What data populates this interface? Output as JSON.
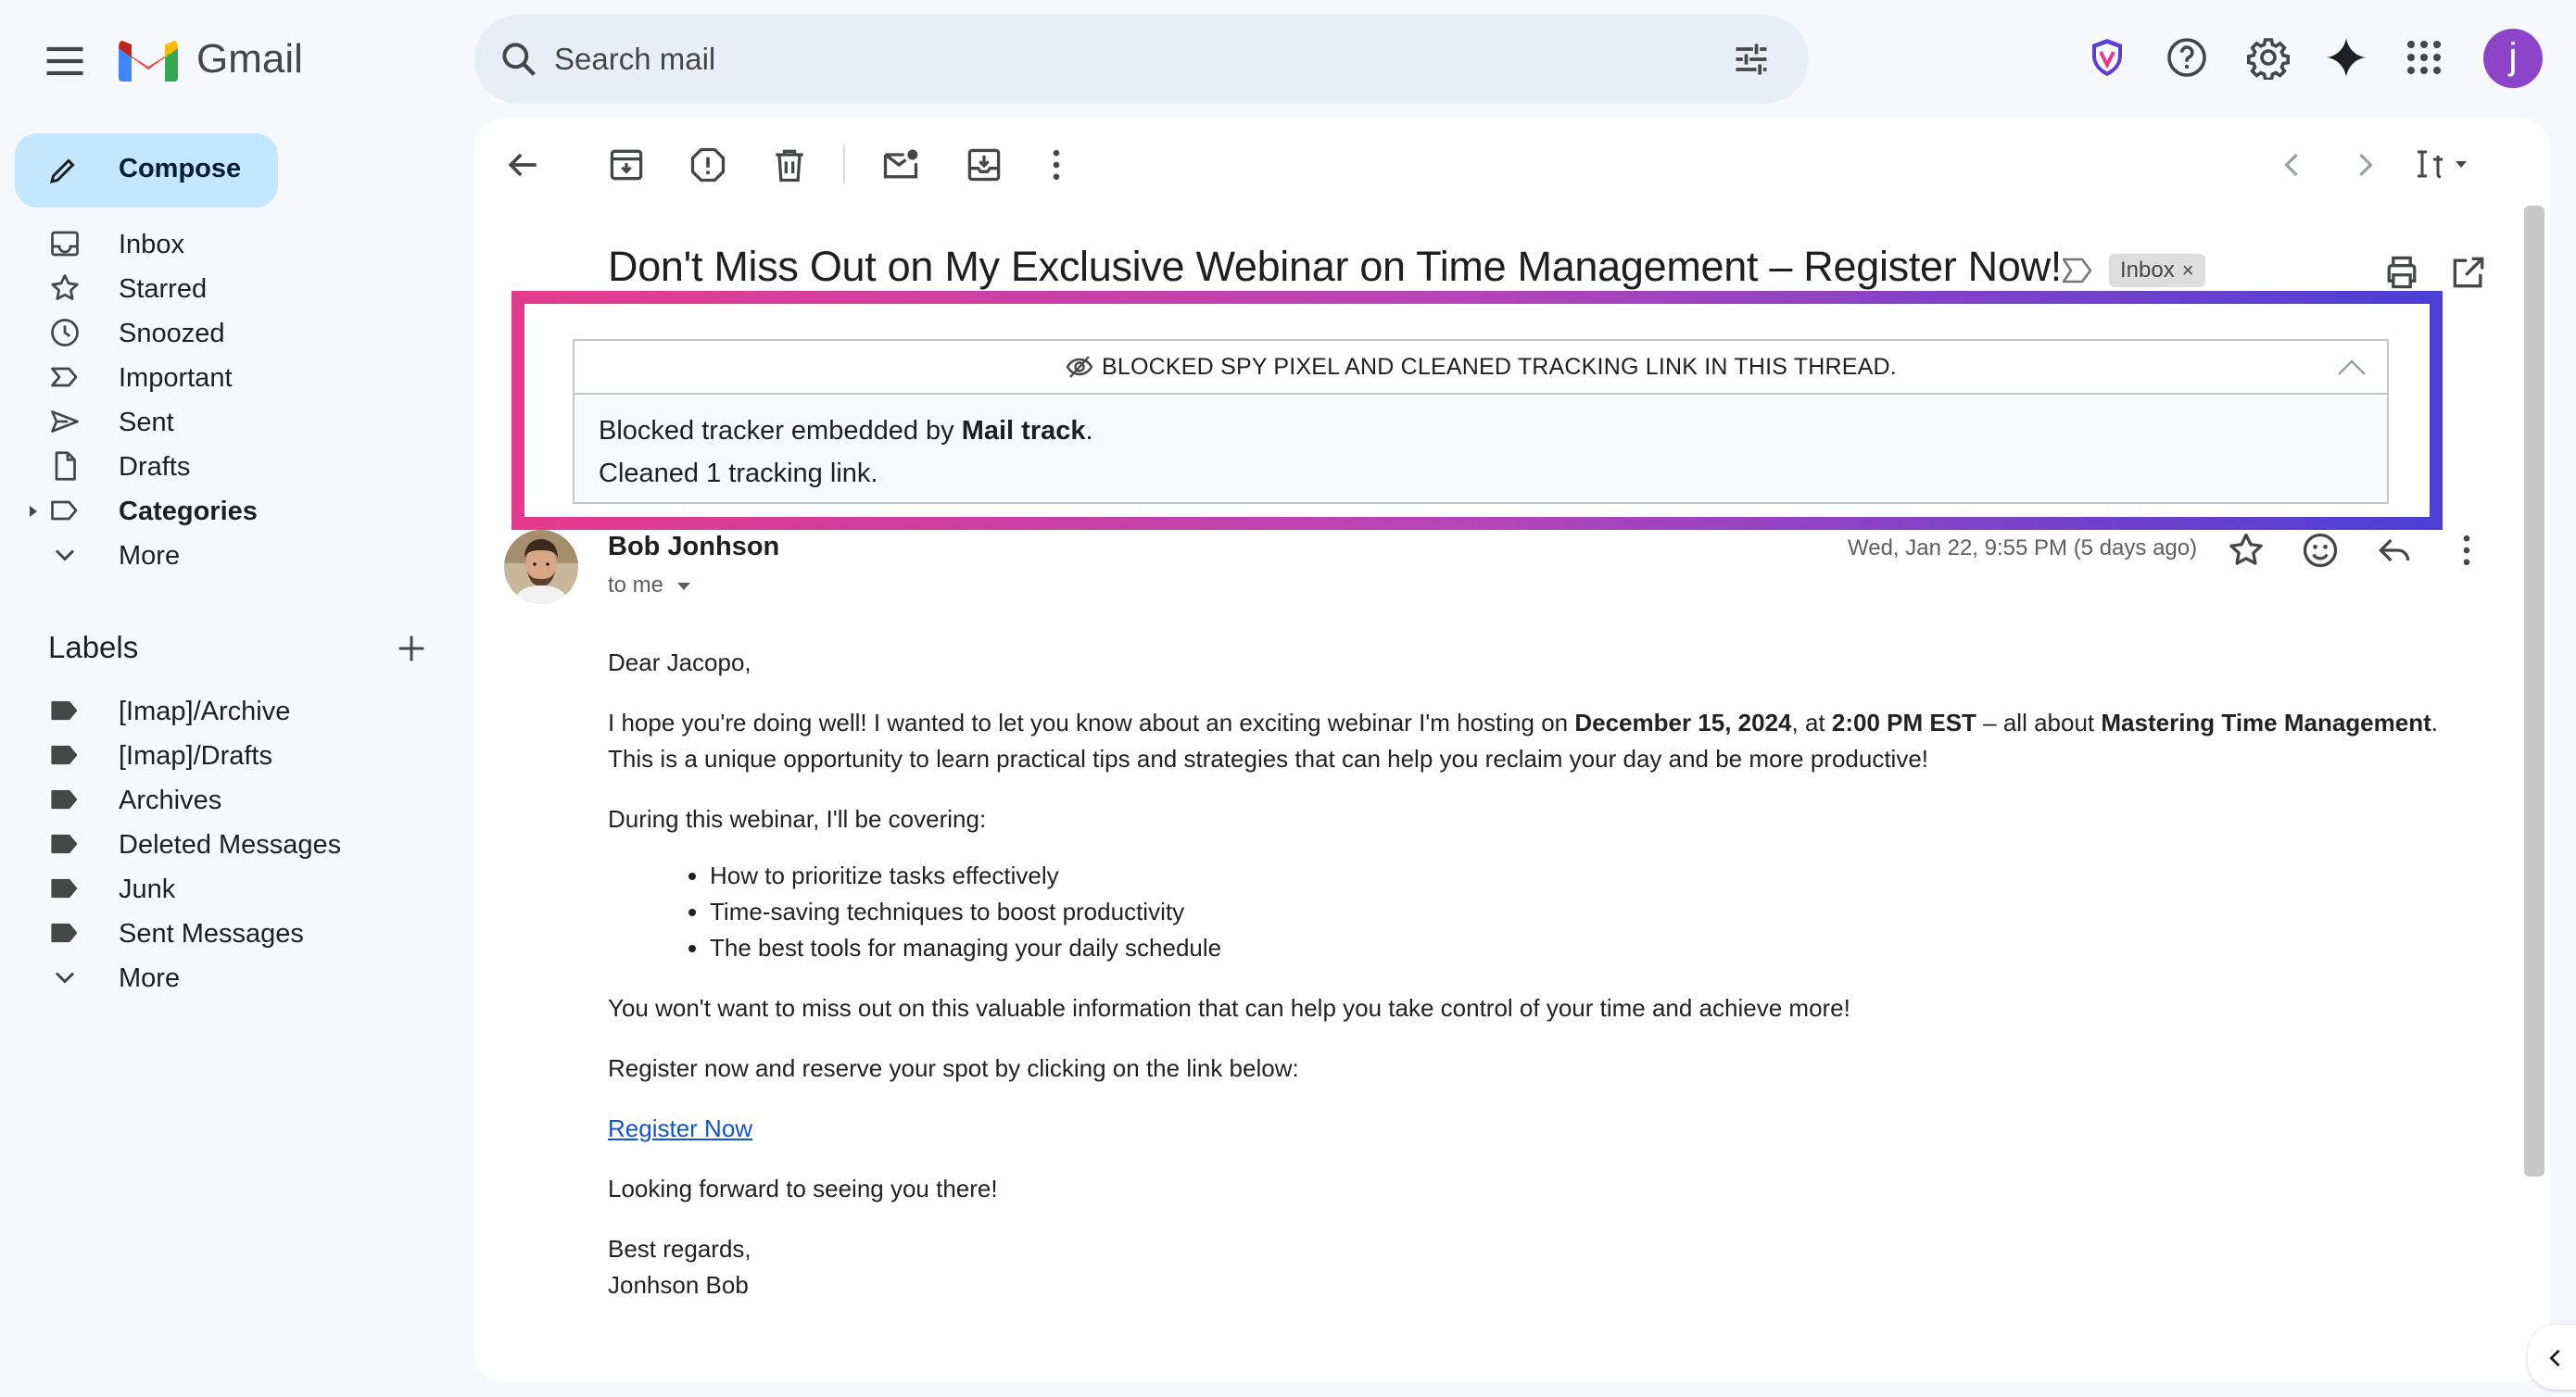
{
  "header": {
    "app_name": "Gmail",
    "search_placeholder": "Search mail",
    "avatar_letter": "j"
  },
  "sidebar": {
    "compose_label": "Compose",
    "items": [
      {
        "label": "Inbox",
        "icon": "inbox-icon"
      },
      {
        "label": "Starred",
        "icon": "star-icon"
      },
      {
        "label": "Snoozed",
        "icon": "clock-icon"
      },
      {
        "label": "Important",
        "icon": "important-icon"
      },
      {
        "label": "Sent",
        "icon": "send-icon"
      },
      {
        "label": "Drafts",
        "icon": "file-icon"
      },
      {
        "label": "Categories",
        "icon": "label-outline-icon"
      },
      {
        "label": "More",
        "icon": "chevron-down-icon"
      }
    ],
    "labels_title": "Labels",
    "labels": [
      {
        "label": "[Imap]/Archive"
      },
      {
        "label": "[Imap]/Drafts"
      },
      {
        "label": "Archives"
      },
      {
        "label": "Deleted Messages"
      },
      {
        "label": "Junk"
      },
      {
        "label": "Sent Messages"
      }
    ],
    "labels_more": "More"
  },
  "email": {
    "subject": "Don't Miss Out on My Exclusive Webinar on Time Management – Register Now!",
    "inbox_chip": "Inbox",
    "inbox_chip_close": "×",
    "tracker": {
      "title": "BLOCKED SPY PIXEL AND CLEANED TRACKING LINK IN THIS THREAD.",
      "line1_prefix": "Blocked tracker embedded by ",
      "line1_bold": "Mail track",
      "line1_suffix": ".",
      "line2": "Cleaned 1 tracking link."
    },
    "sender_name": "Bob Jonhson",
    "to_me": "to me",
    "date": "Wed, Jan 22, 9:55 PM (5 days ago)",
    "body": {
      "greeting": "Dear Jacopo,",
      "p1_a": "I hope you're doing well! I wanted to let you know about an exciting webinar I'm hosting on ",
      "p1_b": "December 15, 2024",
      "p1_c": ", at ",
      "p1_d": "2:00 PM EST",
      "p1_e": " – all about ",
      "p1_f": "Mastering Time Management",
      "p1_g": ". This is a unique opportunity to learn practical tips and strategies that can help you reclaim your day and be more productive!",
      "p2": "During this webinar, I'll be covering:",
      "bullets": [
        "How to prioritize tasks effectively",
        "Time-saving techniques to boost productivity",
        "The best tools for managing your daily schedule"
      ],
      "p3": "You won't want to miss out on this valuable information that can help you take control of your time and achieve more!",
      "p4": "Register now and reserve your spot by clicking on the link below:",
      "link": "Register Now",
      "p5": "Looking forward to seeing you there!",
      "signoff": "Best regards,",
      "signature": "Jonhson Bob"
    }
  },
  "colors": {
    "compose_bg": "#c2e7ff",
    "gradient_start": "#e53b8e",
    "gradient_end": "#4b3fd6",
    "link": "#1155cc"
  }
}
